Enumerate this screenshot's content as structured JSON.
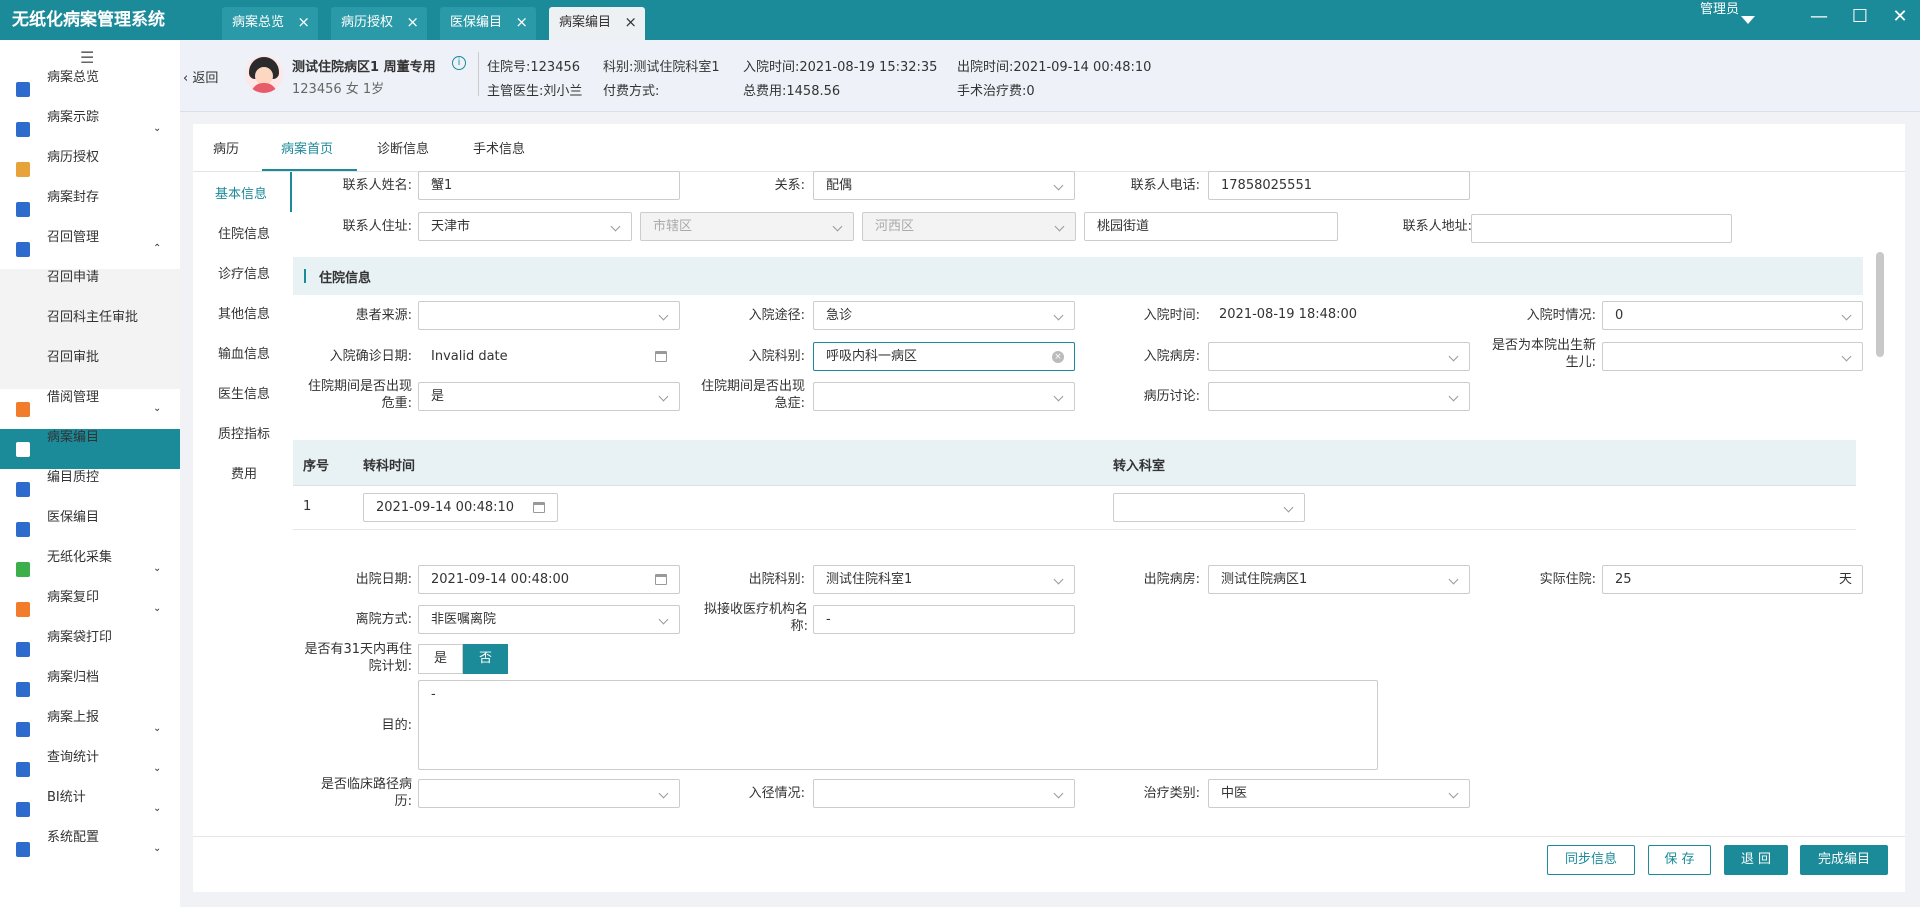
{
  "app": {
    "title": "无纸化病案管理系统"
  },
  "top_tabs": [
    {
      "label": "病案总览",
      "close": "×"
    },
    {
      "label": "病历授权",
      "close": "×"
    },
    {
      "label": "医保编目",
      "close": "×"
    },
    {
      "label": "病案编目",
      "close": "×"
    }
  ],
  "user": {
    "name": "管理员"
  },
  "window": {
    "minimize": "—",
    "maximize": "☐",
    "close": "✕"
  },
  "sidebar": {
    "collapse_icon": "☰",
    "items": [
      {
        "label": "病案总览",
        "icon": "list-icon",
        "color": "#2d6ccc"
      },
      {
        "label": "病案示踪",
        "icon": "location-icon",
        "color": "#2d6ccc",
        "arrow": "⌄"
      },
      {
        "label": "病历授权",
        "icon": "ring-icon",
        "color": "#e8a23a"
      },
      {
        "label": "病案封存",
        "icon": "file-lock-icon",
        "color": "#2d6ccc"
      },
      {
        "label": "召回管理",
        "icon": "list-icon",
        "color": "#2d6ccc",
        "arrow": "⌃"
      },
      {
        "label": "召回申请",
        "sub": true
      },
      {
        "label": "召回科主任审批",
        "sub": true
      },
      {
        "label": "召回审批",
        "sub": true
      },
      {
        "label": "借阅管理",
        "icon": "hand-icon",
        "color": "#f07c2c",
        "arrow": "⌄"
      },
      {
        "label": "病案编目",
        "icon": "list-icon",
        "color": "#2d6ccc",
        "active": true
      },
      {
        "label": "编目质控",
        "icon": "location-icon",
        "color": "#2d6ccc"
      },
      {
        "label": "医保编目",
        "icon": "list-icon",
        "color": "#2d6ccc"
      },
      {
        "label": "无纸化采集",
        "icon": "box-icon",
        "color": "#3cae4a",
        "arrow": "⌄"
      },
      {
        "label": "病案复印",
        "icon": "printer-icon",
        "color": "#f07c2c",
        "arrow": "⌄"
      },
      {
        "label": "病案袋打印",
        "icon": "location-icon",
        "color": "#2d6ccc"
      },
      {
        "label": "病案归档",
        "icon": "list-icon",
        "color": "#2d6ccc"
      },
      {
        "label": "病案上报",
        "icon": "list-icon",
        "color": "#2d6ccc",
        "arrow": "⌄"
      },
      {
        "label": "查询统计",
        "icon": "list-icon",
        "color": "#2d6ccc",
        "arrow": "⌄"
      },
      {
        "label": "BI统计",
        "icon": "list-icon",
        "color": "#2d6ccc",
        "arrow": "⌄"
      },
      {
        "label": "系统配置",
        "icon": "list-icon",
        "color": "#2d6ccc",
        "arrow": "⌄"
      }
    ]
  },
  "patient": {
    "back_label": "返回",
    "name": "测试住院病区1 周董专用",
    "info_icon": "i",
    "sub": "123456 女 1岁",
    "fields": [
      "住院号:123456",
      "主管医生:刘小兰",
      "科别:测试住院科室1",
      "付费方式:",
      "入院时间:2021-08-19 15:32:35",
      "总费用:1458.56",
      "出院时间:2021-09-14 00:48:10",
      "手术治疗费:0"
    ]
  },
  "panel_tabs": [
    "病历",
    "病案首页",
    "诊断信息",
    "手术信息"
  ],
  "side_nav": [
    "基本信息",
    "住院信息",
    "诊疗信息",
    "其他信息",
    "输血信息",
    "医生信息",
    "质控指标",
    "费用"
  ],
  "contact": {
    "name_label": "联系人姓名:",
    "name_value": "蟹1",
    "relation_label": "关系:",
    "relation_value": "配偶",
    "phone_label": "联系人电话:",
    "phone_value": "17858025551",
    "addr_label": "联系人住址:",
    "city": "天津市",
    "district": "市辖区",
    "area": "河西区",
    "street": "桃园街道",
    "address_label": "联系人地址:"
  },
  "section_title": "住院信息",
  "admission": {
    "source_label": "患者来源:",
    "route_label": "入院途径:",
    "route_value": "急诊",
    "time_label": "入院时间:",
    "time_value": "2021-08-19 18:48:00",
    "cond_label": "入院时情况:",
    "cond_value": "0",
    "diag_date_label": "入院确诊日期:",
    "diag_date_value": "Invalid date",
    "dept_label": "入院科别:",
    "dept_value": "呼吸内科一病区",
    "ward_label": "入院病房:",
    "newborn_label_1": "是否为本院出生新",
    "newborn_label_2": "生儿:",
    "danger_label_1": "住院期间是否出现",
    "danger_label_2": "危重:",
    "danger_value": "是",
    "urgent_label_1": "住院期间是否出现",
    "urgent_label_2": "急症:",
    "discuss_label": "病历讨论:"
  },
  "transfer_table": {
    "headers": [
      "序号",
      "转科时间",
      "转入科室"
    ],
    "rows": [
      {
        "no": "1",
        "time": "2021-09-14 00:48:10"
      }
    ]
  },
  "discharge": {
    "date_label": "出院日期:",
    "date_value": "2021-09-14 00:48:00",
    "dept_label": "出院科别:",
    "dept_value": "测试住院科室1",
    "ward_label": "出院病房:",
    "ward_value": "测试住院病区1",
    "days_label": "实际住院:",
    "days_value": "25",
    "days_unit": "天",
    "method_label": "离院方式:",
    "method_value": "非医嘱离院",
    "org_label_1": "拟接收医疗机构名",
    "org_label_2": "称:",
    "org_value": "-",
    "readmit_label_1": "是否有31天内再住",
    "readmit_label_2": "院计划:",
    "readmit_yes": "是",
    "readmit_no": "否",
    "purpose_label": "目的:",
    "purpose_value": "-",
    "path_label_1": "是否临床路径病",
    "path_label_2": "历:",
    "entry_label": "入径情况:",
    "treat_label": "治疗类别:",
    "treat_value": "中医"
  },
  "buttons": {
    "sync": "同步信息",
    "save": "保 存",
    "return": "退 回",
    "finish": "完成编目"
  },
  "colors": {
    "primary": "#1b8a99",
    "topbar": "#1b8a99"
  }
}
